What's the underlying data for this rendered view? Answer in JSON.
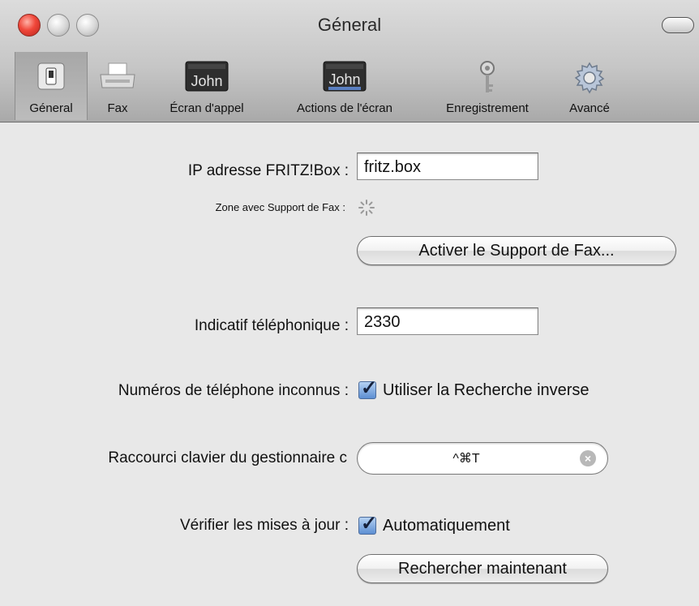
{
  "window": {
    "title": "Géneral"
  },
  "toolbar": {
    "items": [
      {
        "label": "Géneral",
        "icon": "switch-icon"
      },
      {
        "label": "Fax",
        "icon": "fax-icon"
      },
      {
        "label": "Écran d'appel",
        "icon": "caller-screen-icon",
        "icon_text": "John"
      },
      {
        "label": "Actions de l'écran",
        "icon": "screen-actions-icon",
        "icon_text": "John"
      },
      {
        "label": "Enregistrement",
        "icon": "key-icon"
      },
      {
        "label": "Avancé",
        "icon": "gear-icon"
      }
    ]
  },
  "form": {
    "ip_label": "IP adresse FRITZ!Box :",
    "ip_value": "fritz.box",
    "fax_zone_label": "Zone avec Support de Fax :",
    "fax_button": "Activer le Support de Fax...",
    "area_code_label": "Indicatif téléphonique :",
    "area_code_value": "2330",
    "unknown_numbers_label": "Numéros de téléphone inconnus :",
    "reverse_lookup_label": "Utiliser la Recherche inverse",
    "shortcut_label": "Raccourci clavier du gestionnaire c",
    "shortcut_value": "^⌘T",
    "updates_label": "Vérifier les mises à jour :",
    "auto_label": "Automatiquement",
    "check_now_button": "Rechercher maintenant"
  },
  "colors": {
    "checkbox": "#5d8fd3",
    "close": "#f0473a"
  }
}
